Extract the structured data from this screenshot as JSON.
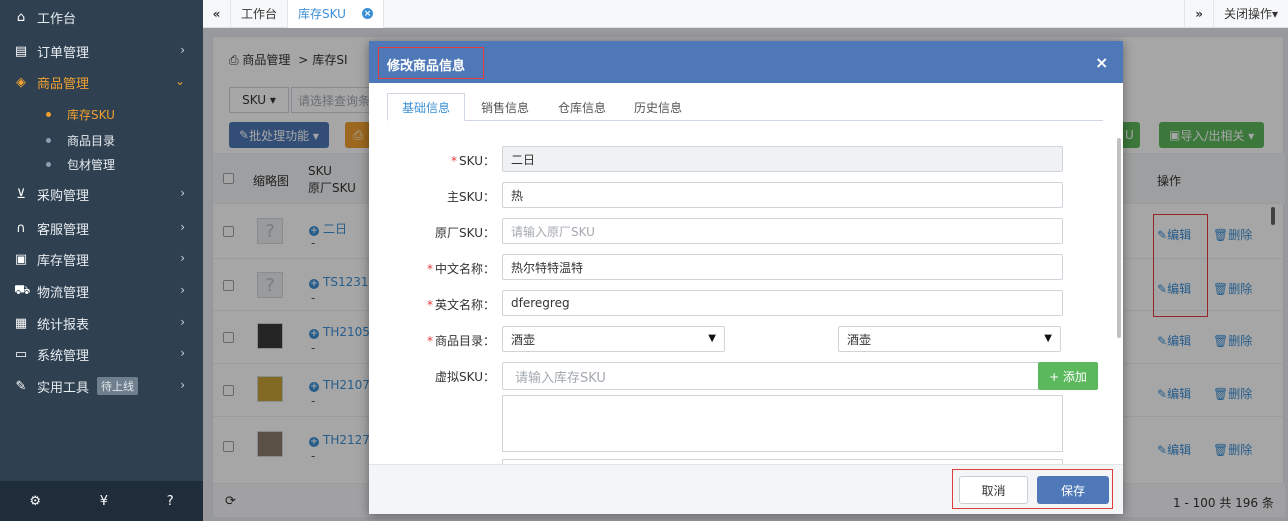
{
  "sidebar": {
    "items": [
      {
        "label": "工作台",
        "icon": "home-icon",
        "glyph": "🏠"
      },
      {
        "label": "订单管理",
        "icon": "clipboard-icon",
        "glyph": "▤"
      },
      {
        "label": "商品管理",
        "icon": "cube-icon",
        "glyph": "◈"
      },
      {
        "label": "采购管理",
        "icon": "cart-icon",
        "glyph": "🛒"
      },
      {
        "label": "客服管理",
        "icon": "headset-icon",
        "glyph": "∩"
      },
      {
        "label": "库存管理",
        "icon": "printer-icon",
        "glyph": "▣"
      },
      {
        "label": "物流管理",
        "icon": "truck-icon",
        "glyph": "⛟"
      },
      {
        "label": "统计报表",
        "icon": "report-icon",
        "glyph": "▦"
      },
      {
        "label": "系统管理",
        "icon": "monitor-icon",
        "glyph": "▭"
      },
      {
        "label": "实用工具",
        "icon": "wrench-icon",
        "glyph": "✎"
      }
    ],
    "sub_items": [
      "库存SKU",
      "商品目录",
      "包材管理"
    ],
    "tools_badge": "待上线",
    "footer_icons": [
      "gear-icon",
      "yen-icon",
      "help-icon"
    ]
  },
  "tabbar": {
    "back_icon": "«",
    "tabs": [
      "工作台",
      "库存SKU"
    ],
    "forward_icon": "»",
    "close_ops": "关闭操作▾"
  },
  "main": {
    "breadcrumb": {
      "root": "商品管理",
      "sep": ">",
      "current": "库存SI"
    },
    "search": {
      "field_select": "SKU ▾",
      "placeholder": "请选择查询条"
    },
    "toolbar": {
      "batch": "批处理功能 ▾",
      "print": "⎙",
      "import_export": "导入/出相关 ▾",
      "u_btn": "U"
    },
    "columns": {
      "thumb": "缩略图",
      "sku": "SKU",
      "factory_sku": "原厂SKU",
      "actions": "操作"
    },
    "rows": [
      {
        "sku": "二日",
        "sub": "-",
        "thumb": "?"
      },
      {
        "sku": "TS12312",
        "sub": "-",
        "thumb": "?"
      },
      {
        "sku": "TH2105",
        "sub": "-",
        "thumb": "img"
      },
      {
        "sku": "TH2107",
        "sub": "-",
        "thumb": "img"
      },
      {
        "sku": "TH2127Z",
        "sub": "-",
        "thumb": "img"
      }
    ],
    "edit": "编辑",
    "delete": "删除",
    "pagination": "1 - 100  共 196 条",
    "refresh": "⟳"
  },
  "modal": {
    "title": "修改商品信息",
    "close": "×",
    "tabs": [
      "基础信息",
      "销售信息",
      "仓库信息",
      "历史信息"
    ],
    "fields": {
      "sku": {
        "label": "SKU：",
        "value": "二日"
      },
      "main_sku": {
        "label": "主SKU：",
        "value": "热"
      },
      "factory_sku": {
        "label": "原厂SKU：",
        "placeholder": "请输入原厂SKU"
      },
      "cn_name": {
        "label": "中文名称：",
        "value": "热尔特特温特"
      },
      "en_name": {
        "label": "英文名称：",
        "value": "dferegreg"
      },
      "catalog": {
        "label": "商品目录：",
        "value1": "酒壶",
        "value2": "酒壶"
      },
      "virtual_sku": {
        "label": "虚拟SKU：",
        "placeholder": "请输入库存SKU",
        "add": "+ 添加"
      }
    },
    "cancel": "取消",
    "save": "保存"
  },
  "colors": {
    "sidebar": "#2f4050",
    "accent": "#3b8fd6",
    "orange": "#f0a030",
    "modal_header": "#4e78b7",
    "green": "#5cb85c",
    "highlight": "#e23b3b"
  }
}
